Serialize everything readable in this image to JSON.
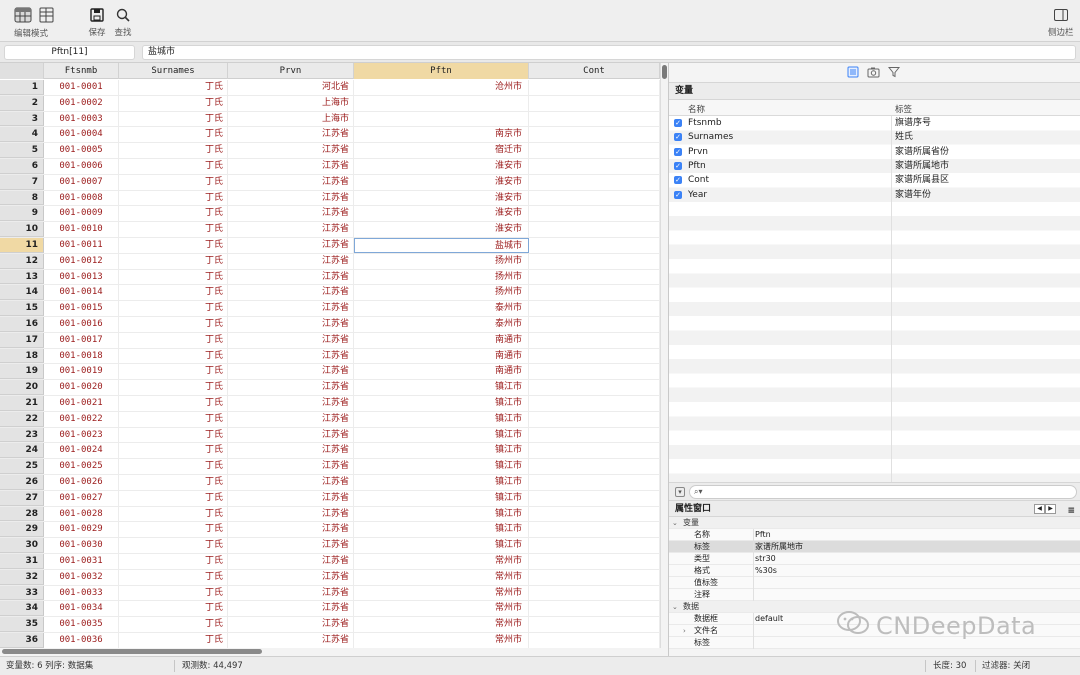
{
  "toolbar": {
    "edit_mode_label": "编辑模式",
    "save_label": "保存",
    "find_label": "查找",
    "sidebar_label": "侧边栏"
  },
  "editor": {
    "cell_ref": "Pftn[11]",
    "cell_value": "盐城市"
  },
  "grid": {
    "columns": [
      "Ftsnmb",
      "Surnames",
      "Prvn",
      "Pftn",
      "Cont"
    ],
    "active_column": "Pftn",
    "active_row": 11,
    "rows": [
      {
        "n": "1",
        "f": "001-0001",
        "s": "丁氏",
        "p": "河北省",
        "pf": "沧州市"
      },
      {
        "n": "2",
        "f": "001-0002",
        "s": "丁氏",
        "p": "上海市",
        "pf": ""
      },
      {
        "n": "3",
        "f": "001-0003",
        "s": "丁氏",
        "p": "上海市",
        "pf": ""
      },
      {
        "n": "4",
        "f": "001-0004",
        "s": "丁氏",
        "p": "江苏省",
        "pf": "南京市"
      },
      {
        "n": "5",
        "f": "001-0005",
        "s": "丁氏",
        "p": "江苏省",
        "pf": "宿迁市"
      },
      {
        "n": "6",
        "f": "001-0006",
        "s": "丁氏",
        "p": "江苏省",
        "pf": "淮安市"
      },
      {
        "n": "7",
        "f": "001-0007",
        "s": "丁氏",
        "p": "江苏省",
        "pf": "淮安市"
      },
      {
        "n": "8",
        "f": "001-0008",
        "s": "丁氏",
        "p": "江苏省",
        "pf": "淮安市"
      },
      {
        "n": "9",
        "f": "001-0009",
        "s": "丁氏",
        "p": "江苏省",
        "pf": "淮安市"
      },
      {
        "n": "10",
        "f": "001-0010",
        "s": "丁氏",
        "p": "江苏省",
        "pf": "淮安市"
      },
      {
        "n": "11",
        "f": "001-0011",
        "s": "丁氏",
        "p": "江苏省",
        "pf": "盐城市"
      },
      {
        "n": "12",
        "f": "001-0012",
        "s": "丁氏",
        "p": "江苏省",
        "pf": "扬州市"
      },
      {
        "n": "13",
        "f": "001-0013",
        "s": "丁氏",
        "p": "江苏省",
        "pf": "扬州市"
      },
      {
        "n": "14",
        "f": "001-0014",
        "s": "丁氏",
        "p": "江苏省",
        "pf": "扬州市"
      },
      {
        "n": "15",
        "f": "001-0015",
        "s": "丁氏",
        "p": "江苏省",
        "pf": "泰州市"
      },
      {
        "n": "16",
        "f": "001-0016",
        "s": "丁氏",
        "p": "江苏省",
        "pf": "泰州市"
      },
      {
        "n": "17",
        "f": "001-0017",
        "s": "丁氏",
        "p": "江苏省",
        "pf": "南通市"
      },
      {
        "n": "18",
        "f": "001-0018",
        "s": "丁氏",
        "p": "江苏省",
        "pf": "南通市"
      },
      {
        "n": "19",
        "f": "001-0019",
        "s": "丁氏",
        "p": "江苏省",
        "pf": "南通市"
      },
      {
        "n": "20",
        "f": "001-0020",
        "s": "丁氏",
        "p": "江苏省",
        "pf": "镇江市"
      },
      {
        "n": "21",
        "f": "001-0021",
        "s": "丁氏",
        "p": "江苏省",
        "pf": "镇江市"
      },
      {
        "n": "22",
        "f": "001-0022",
        "s": "丁氏",
        "p": "江苏省",
        "pf": "镇江市"
      },
      {
        "n": "23",
        "f": "001-0023",
        "s": "丁氏",
        "p": "江苏省",
        "pf": "镇江市"
      },
      {
        "n": "24",
        "f": "001-0024",
        "s": "丁氏",
        "p": "江苏省",
        "pf": "镇江市"
      },
      {
        "n": "25",
        "f": "001-0025",
        "s": "丁氏",
        "p": "江苏省",
        "pf": "镇江市"
      },
      {
        "n": "26",
        "f": "001-0026",
        "s": "丁氏",
        "p": "江苏省",
        "pf": "镇江市"
      },
      {
        "n": "27",
        "f": "001-0027",
        "s": "丁氏",
        "p": "江苏省",
        "pf": "镇江市"
      },
      {
        "n": "28",
        "f": "001-0028",
        "s": "丁氏",
        "p": "江苏省",
        "pf": "镇江市"
      },
      {
        "n": "29",
        "f": "001-0029",
        "s": "丁氏",
        "p": "江苏省",
        "pf": "镇江市"
      },
      {
        "n": "30",
        "f": "001-0030",
        "s": "丁氏",
        "p": "江苏省",
        "pf": "镇江市"
      },
      {
        "n": "31",
        "f": "001-0031",
        "s": "丁氏",
        "p": "江苏省",
        "pf": "常州市"
      },
      {
        "n": "32",
        "f": "001-0032",
        "s": "丁氏",
        "p": "江苏省",
        "pf": "常州市"
      },
      {
        "n": "33",
        "f": "001-0033",
        "s": "丁氏",
        "p": "江苏省",
        "pf": "常州市"
      },
      {
        "n": "34",
        "f": "001-0034",
        "s": "丁氏",
        "p": "江苏省",
        "pf": "常州市"
      },
      {
        "n": "35",
        "f": "001-0035",
        "s": "丁氏",
        "p": "江苏省",
        "pf": "常州市"
      },
      {
        "n": "36",
        "f": "001-0036",
        "s": "丁氏",
        "p": "江苏省",
        "pf": "常州市"
      }
    ]
  },
  "variables": {
    "title": "变量",
    "col_name": "名称",
    "col_label": "标签",
    "items": [
      {
        "name": "Ftsnmb",
        "label": "旗谱序号"
      },
      {
        "name": "Surnames",
        "label": "姓氏"
      },
      {
        "name": "Prvn",
        "label": "家谱所属省份"
      },
      {
        "name": "Pftn",
        "label": "家谱所属地市"
      },
      {
        "name": "Cont",
        "label": "家谱所属县区"
      },
      {
        "name": "Year",
        "label": "家谱年份"
      }
    ]
  },
  "properties": {
    "title": "属性窗口",
    "sections": [
      {
        "type": "sec",
        "k": "变量"
      },
      {
        "type": "row",
        "k": "名称",
        "v": "Pftn"
      },
      {
        "type": "row",
        "k": "标签",
        "v": "家谱所属地市",
        "sel": true
      },
      {
        "type": "row",
        "k": "类型",
        "v": "str30"
      },
      {
        "type": "row",
        "k": "格式",
        "v": "%30s"
      },
      {
        "type": "row",
        "k": "值标签",
        "v": ""
      },
      {
        "type": "row",
        "k": "注释",
        "v": ""
      },
      {
        "type": "sec",
        "k": "数据"
      },
      {
        "type": "row",
        "k": "数据框",
        "v": "default"
      },
      {
        "type": "row",
        "k": "文件名",
        "v": "",
        "caret": true
      },
      {
        "type": "row",
        "k": "标签",
        "v": ""
      }
    ]
  },
  "watermark": "CNDeepData",
  "status": {
    "vars": "变量数: 6  列序: 数据集",
    "obs": "观测数: 44,497",
    "length": "长度: 30",
    "filter": "过滤器: 关闭"
  },
  "colors": {
    "data_text": "#9b1b1b",
    "active_header": "#f0d9a4",
    "checkbox": "#3b82f6"
  }
}
